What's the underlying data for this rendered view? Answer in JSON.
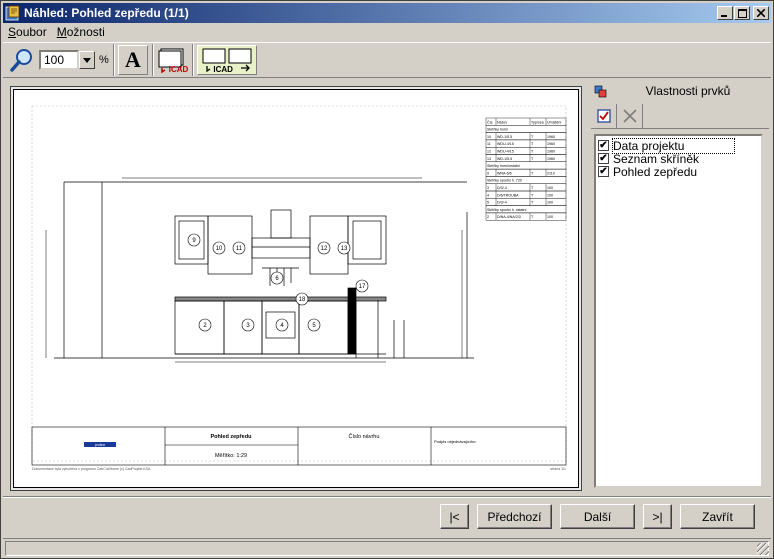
{
  "window": {
    "title": "Náhled: Pohled zepředu (1/1)",
    "controls": [
      "_",
      "□",
      "×"
    ]
  },
  "menu": {
    "items": [
      {
        "label": "Soubor",
        "accel": "S",
        "rest": "oubor"
      },
      {
        "label": "Možnosti",
        "accel": "M",
        "rest": "ožnosti"
      }
    ]
  },
  "toolbar": {
    "zoom_value": "100",
    "zoom_unit": "%",
    "font_glyph": "A",
    "icad_label": "ICAD",
    "icad2_label": "ICAD"
  },
  "drawing": {
    "title": "Pohled zepředu",
    "scale": "Měřítko: 1:29",
    "design_number": "Číslo návrhu",
    "signature": "Podpis objednávajícího:",
    "footer_left": "Dokumentace byla vytvořena v programu CabCut/Home (c) CadProjekt KSA",
    "footer_right": "strana 1/1",
    "logo": "proline",
    "table_headers": [
      "Čís.",
      "Název",
      "Typ/osa",
      "Umístění"
    ],
    "table_rows": [
      [
        "Skříňky horní",
        "",
        "",
        ""
      ],
      [
        "10",
        "WD-1/5.5",
        "T",
        "1960"
      ],
      [
        "11",
        "WDU-4/15",
        "T",
        "1960"
      ],
      [
        "12",
        "WDU-4/15",
        "T",
        "1960"
      ],
      [
        "13",
        "WD-1/5.5",
        "T",
        "1960"
      ],
      [
        "Skříňky horní/ostatní",
        "",
        "",
        ""
      ],
      [
        "9",
        "WNA-6/6",
        "T",
        "2110"
      ],
      [
        "Skříňky spodní h. 720",
        "",
        "",
        ""
      ],
      [
        "3",
        "D/3/-4",
        "T",
        "100"
      ],
      [
        "4",
        "D/6/TROUBA",
        "T",
        "100"
      ],
      [
        "5",
        "D/3/-4",
        "T",
        "100"
      ],
      [
        "Skříňky spodní h. ostatní",
        "",
        "",
        ""
      ],
      [
        "2",
        "D/NA-4/NA/2/3",
        "T",
        "100"
      ]
    ],
    "labels": [
      "9",
      "10",
      "11",
      "12",
      "13",
      "2",
      "3",
      "4",
      "5",
      "17",
      "18",
      "6"
    ]
  },
  "side_panel": {
    "title": "Vlastnosti prvků",
    "items": [
      {
        "label": "Data projektu",
        "checked": true,
        "focused": true
      },
      {
        "label": "Seznam skříněk",
        "checked": true,
        "focused": false
      },
      {
        "label": "Pohled zepředu",
        "checked": true,
        "focused": false
      }
    ],
    "check_glyph": "✔"
  },
  "nav": {
    "first": "|<",
    "prev": "Předchozí",
    "next": "Další",
    "last": ">|",
    "close": "Zavřít"
  },
  "colors": {
    "title_start": "#0a246a",
    "title_end": "#a6caf0",
    "face": "#d4d0c8"
  }
}
